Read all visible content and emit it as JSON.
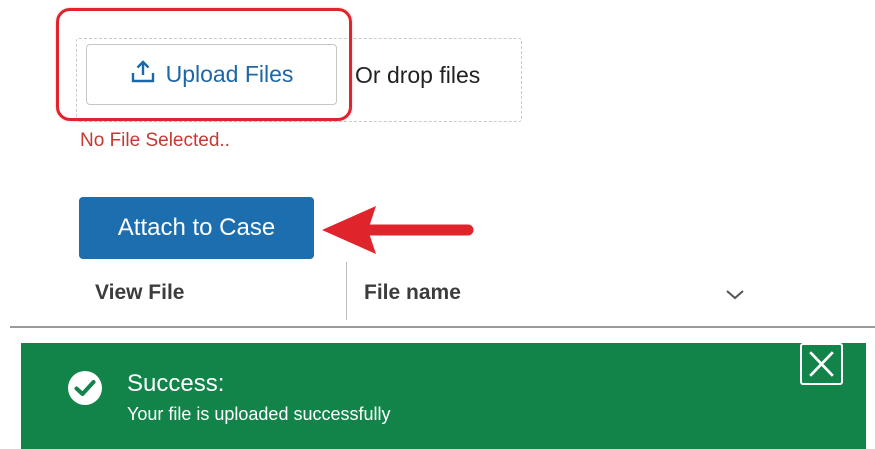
{
  "upload": {
    "button_label": "Upload Files",
    "drop_hint": "Or drop files",
    "status": "No File Selected..",
    "icon": "upload-icon"
  },
  "attach": {
    "button_label": "Attach to Case"
  },
  "table": {
    "columns": [
      "View File",
      "File name"
    ],
    "sort_icon": "chevron-down-icon"
  },
  "toast": {
    "title": "Success:",
    "message": "Your file is uploaded successfully",
    "icon": "check-circle-icon",
    "close_icon": "close-icon"
  },
  "colors": {
    "accent_blue": "#1c6eae",
    "success_green": "#12844a",
    "error_red": "#c23a31",
    "annotation_red": "#e0242b"
  }
}
